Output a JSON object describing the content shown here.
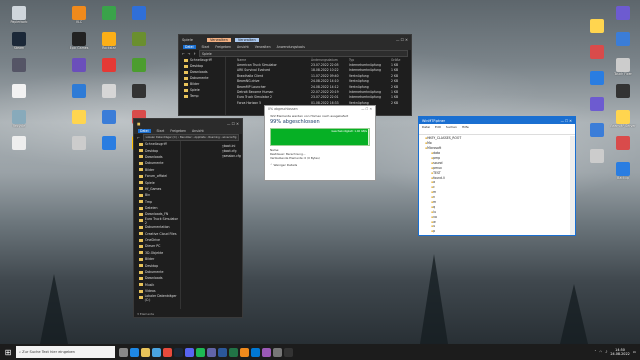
{
  "desktop": {
    "icons": [
      {
        "label": "Papierkorb",
        "color": "#cfd6dc"
      },
      {
        "label": "VLC",
        "color": "#f08a1c"
      },
      {
        "label": "",
        "color": "#3aa34a"
      },
      {
        "label": "",
        "color": "#2f6fd8"
      },
      {
        "label": "Steam",
        "color": "#1b2838"
      },
      {
        "label": "Epic Games",
        "color": "#222"
      },
      {
        "label": "Rockstar",
        "color": "#fcaf17"
      },
      {
        "label": "",
        "color": "#6a8f2f"
      },
      {
        "label": "",
        "color": "#556"
      },
      {
        "label": "",
        "color": "#6b4fbb"
      },
      {
        "label": "",
        "color": "#e53935"
      },
      {
        "label": "",
        "color": "#4c9d2f"
      },
      {
        "label": "",
        "color": "#f2f2f2"
      },
      {
        "label": "",
        "color": "#2e7bd6"
      },
      {
        "label": "",
        "color": "#d6d6d6"
      },
      {
        "label": "",
        "color": "#333"
      },
      {
        "label": "Recycle",
        "color": "#8ab"
      },
      {
        "label": "",
        "color": "#ffd54f"
      },
      {
        "label": "",
        "color": "#3b7dd8"
      },
      {
        "label": "",
        "color": "#d94b4b"
      },
      {
        "label": "",
        "color": "#eee"
      },
      {
        "label": "",
        "color": "#ccc"
      },
      {
        "label": "",
        "color": "#2a7de1"
      },
      {
        "label": "",
        "color": "#ffc107"
      }
    ],
    "right_labels": [
      "",
      "",
      "",
      "",
      "Touch Fixer",
      "",
      "",
      "",
      "BeamMP Server",
      "",
      "",
      "",
      "Backup"
    ]
  },
  "explorer_top": {
    "title": "Spiele",
    "tabs": [
      "Datei",
      "Start",
      "Freigeben",
      "Ansicht",
      "Verwalten",
      "Anwendungstools"
    ],
    "highlight_tabs": [
      "Verwalten",
      "Verwalten"
    ],
    "address": "Spiele",
    "columns": [
      "Name",
      "Änderungsdatum",
      "Typ",
      "Größe"
    ],
    "nav": [
      "Schnellzugriff",
      "Desktop",
      "Downloads",
      "Dokumente",
      "Bilder",
      "Spiele",
      "Temp"
    ],
    "rows": [
      [
        "American Truck Simulator",
        "23.07.2022 22:05",
        "Internetverknüpfung",
        "1 KB"
      ],
      [
        "ARK Survival Evolved",
        "18.08.2022 10:22",
        "Internetverknüpfung",
        "1 KB"
      ],
      [
        "Brawlhalla Client",
        "11.07.2022 09:40",
        "Verknüpfung",
        "2 KB"
      ],
      [
        "BeamNG.drive",
        "24.08.2022 14:10",
        "Verknüpfung",
        "2 KB"
      ],
      [
        "BeamMP Launcher",
        "24.08.2022 14:12",
        "Verknüpfung",
        "2 KB"
      ],
      [
        "Detroit Become Human",
        "22.07.2022 20:19",
        "Internetverknüpfung",
        "1 KB"
      ],
      [
        "Euro Truck Simulator 2",
        "23.07.2022 22:01",
        "Internetverknüpfung",
        "1 KB"
      ],
      [
        "Forza Horizon 5",
        "01.08.2022 16:33",
        "Verknüpfung",
        "2 KB"
      ]
    ]
  },
  "explorer_left": {
    "title": "",
    "tabs": [
      "Datei",
      "Start",
      "Freigeben",
      "Ansicht"
    ],
    "address_parts": [
      "Lokaler Datenträger (C:)",
      "Benutzer",
      "AppData",
      "Roaming",
      "wineconfig"
    ],
    "nav": [
      "Schnellzugriff",
      "Desktop",
      "Downloads",
      "Dokumente",
      "Bilder",
      "Forum_offiziel",
      "Spiele",
      "Hf_Games",
      "Bin",
      "Tmp",
      "Dateien",
      "Downloads_FN",
      "Euro Truck Simulator 2",
      "Dokumentation",
      "Creative Cloud Files",
      "OneDrive",
      "Dieser PC",
      "3D-Objekte",
      "Bilder",
      "Desktop",
      "Dokumente",
      "Downloads",
      "Musik",
      "Videos",
      "Lokaler Datenträger (C:)"
    ],
    "files": [
      "boot.ini",
      "boot.cfg",
      "session.cfg"
    ],
    "status": "3 Elemente"
  },
  "copy_dialog": {
    "title": "0% abgeschlossen",
    "subtitle": "322 Elemente werden von Homeo nach ausgeliefert",
    "percent": "99% abgeschlossen",
    "speed": "Geschwindigkeit: 1,40 GB/s",
    "progress": 0.99,
    "name_label": "Name: ",
    "remaining_label": "Restdauer: Berechnung...",
    "items_label": "Verbleibende Elemente: 0 (0 Bytes)",
    "more_label": "Weniger Details"
  },
  "regedit": {
    "title": "WinMTP.ptner",
    "menu": [
      "Datei",
      "Edit",
      "Suchen",
      "Hilfe"
    ],
    "tree": [
      "HKEY_CLASSES_ROOT",
      "Mo",
      "Microsoft",
      "data",
      "pmp",
      "sound",
      "pmux",
      "TEST",
      "found.li",
      "a",
      "c",
      "m",
      "n",
      "m",
      "q",
      "lu",
      "vo",
      "w",
      "u",
      "p"
    ]
  },
  "taskbar": {
    "search_placeholder": "Zur Suche Text hier eingeben",
    "time": "14:50",
    "date": "24.08.2022",
    "tray": "",
    "apps": [
      "task-view",
      "edge",
      "explorer",
      "store",
      "chrome",
      "steam",
      "discord",
      "spotify",
      "teams",
      "word",
      "excel",
      "vlc",
      "mail",
      "photos",
      "settings",
      "terminal"
    ]
  }
}
